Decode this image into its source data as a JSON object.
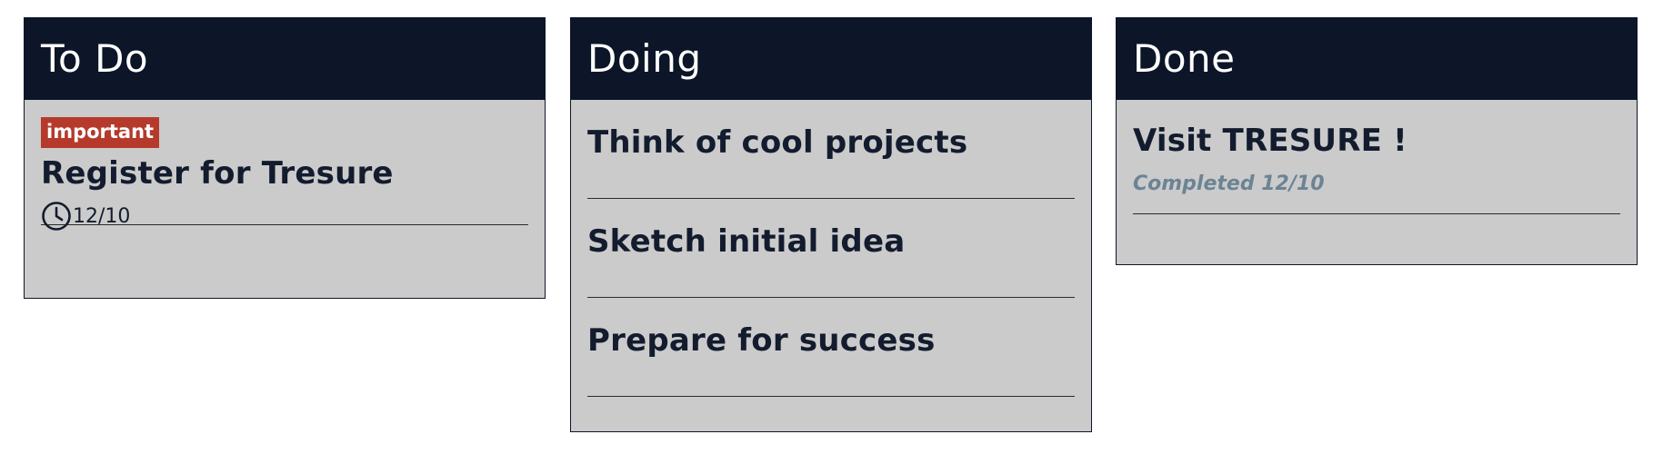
{
  "columns": {
    "todo": {
      "title": "To Do",
      "card": {
        "tag": "important",
        "title": "Register for Tresure",
        "due": "12/10",
        "due_icon": "clock-icon"
      }
    },
    "doing": {
      "title": "Doing",
      "cards": [
        {
          "title": "Think of cool projects"
        },
        {
          "title": "Sketch initial idea"
        },
        {
          "title": "Prepare for success"
        }
      ]
    },
    "done": {
      "title": "Done",
      "card": {
        "title": "Visit TRESURE !",
        "completed": "Completed 12/10"
      }
    }
  },
  "colors": {
    "header_bg": "#0d1628",
    "column_bg": "#cbcbcb",
    "tag_important": "#b53a2c",
    "completed_text": "#6b8494"
  }
}
